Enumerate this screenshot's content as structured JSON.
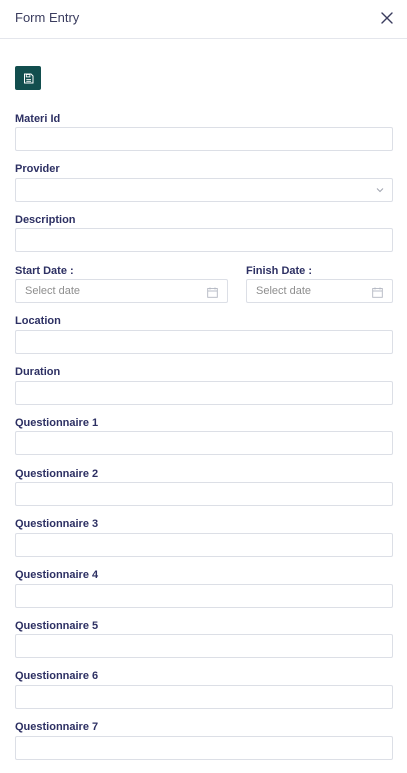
{
  "header": {
    "title": "Form Entry",
    "close_icon": "close-icon"
  },
  "toolbar": {
    "save_icon": "save-icon",
    "accent_color": "#124e4e"
  },
  "form": {
    "materi_id": {
      "label": "Materi Id",
      "value": ""
    },
    "provider": {
      "label": "Provider",
      "value": ""
    },
    "description": {
      "label": "Description",
      "value": ""
    },
    "start_date": {
      "label": "Start Date :",
      "placeholder": "Select date"
    },
    "finish_date": {
      "label": "Finish Date :",
      "placeholder": "Select date"
    },
    "location": {
      "label": "Location",
      "value": ""
    },
    "duration": {
      "label": "Duration",
      "value": ""
    },
    "questionnaire_1": {
      "label": "Questionnaire 1",
      "value": ""
    },
    "questionnaire_2": {
      "label": "Questionnaire 2",
      "value": ""
    },
    "questionnaire_3": {
      "label": "Questionnaire 3",
      "value": ""
    },
    "questionnaire_4": {
      "label": "Questionnaire 4",
      "value": ""
    },
    "questionnaire_5": {
      "label": "Questionnaire 5",
      "value": ""
    },
    "questionnaire_6": {
      "label": "Questionnaire 6",
      "value": ""
    },
    "questionnaire_7": {
      "label": "Questionnaire 7",
      "value": ""
    }
  }
}
